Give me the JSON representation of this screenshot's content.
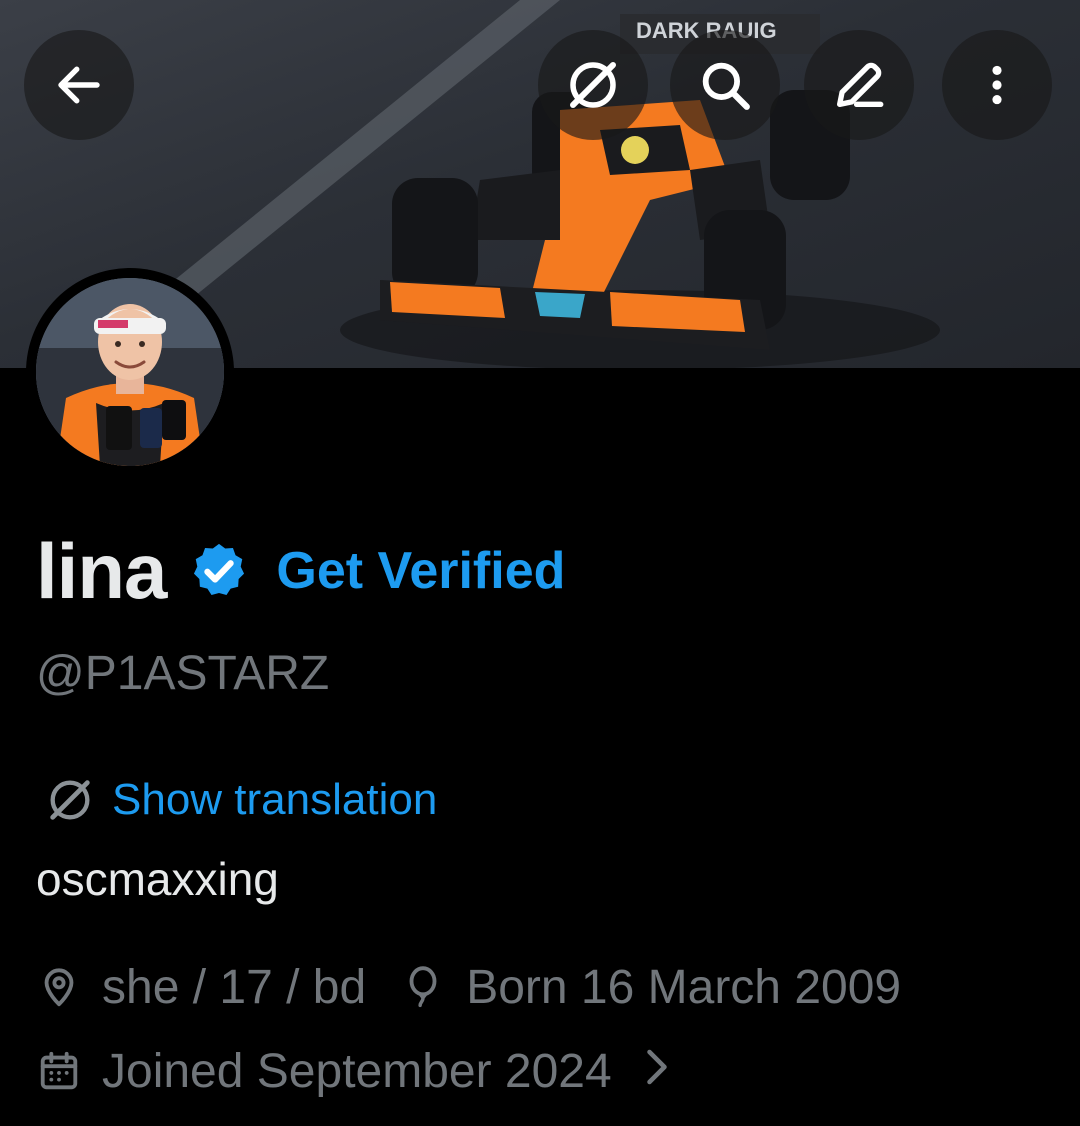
{
  "header": {
    "back_icon": "arrow-left-icon",
    "translate_icon": "translate-globe-icon",
    "search_icon": "search-icon",
    "edit_icon": "pencil-icon",
    "more_icon": "more-vertical-icon"
  },
  "banner": {
    "car_text": "DARK RAUIG"
  },
  "profile": {
    "display_name": "lina",
    "verified_badge_icon": "verified-check-icon",
    "get_verified_label": "Get Verified",
    "handle": "@P1ASTARZ",
    "show_translation_label": "Show translation",
    "bio": "oscmaxxing",
    "meta": {
      "location_icon": "location-pin-icon",
      "location": "she / 17 / bd",
      "birthday_icon": "balloon-icon",
      "birthday": "Born 16 March 2009",
      "joined_icon": "calendar-icon",
      "joined": "Joined September 2024",
      "joined_chevron": "›"
    }
  },
  "colors": {
    "accent": "#1d9bf0",
    "text_primary": "#e7e9ea",
    "text_secondary": "#71767b",
    "background": "#000000",
    "car_orange": "#f47a20"
  }
}
